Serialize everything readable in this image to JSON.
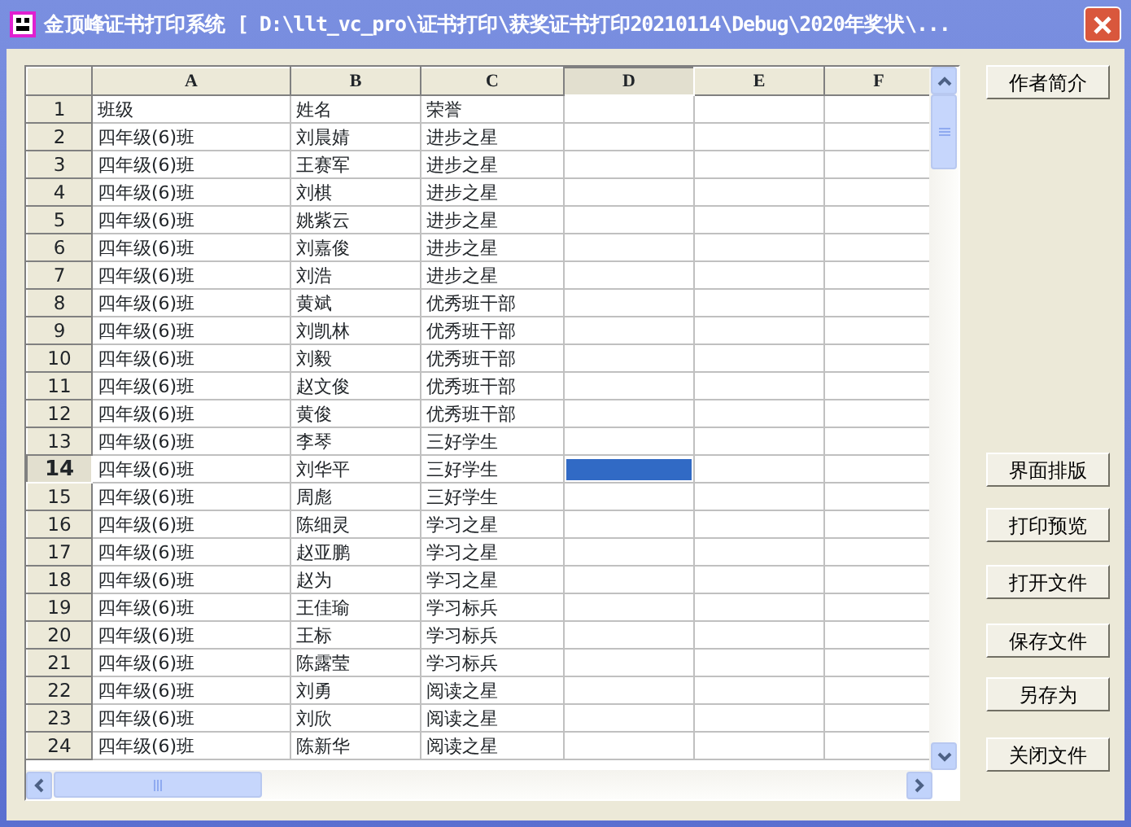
{
  "window": {
    "title": "金顶峰证书打印系统 [ D:\\llt_vc_pro\\证书打印\\获奖证书打印20210114\\Debug\\2020年奖状\\..."
  },
  "columns": [
    {
      "label": "A",
      "selected": false
    },
    {
      "label": "B",
      "selected": false
    },
    {
      "label": "C",
      "selected": false
    },
    {
      "label": "D",
      "selected": true
    },
    {
      "label": "E",
      "selected": false
    },
    {
      "label": "F",
      "selected": false
    }
  ],
  "rows": [
    {
      "label": "1",
      "selected": false,
      "cells": [
        "班级",
        "姓名",
        "荣誉"
      ]
    },
    {
      "label": "2",
      "selected": false,
      "cells": [
        "四年级(6)班",
        "刘晨婧",
        "进步之星"
      ]
    },
    {
      "label": "3",
      "selected": false,
      "cells": [
        "四年级(6)班",
        "王赛军",
        "进步之星"
      ]
    },
    {
      "label": "4",
      "selected": false,
      "cells": [
        "四年级(6)班",
        "刘棋",
        "进步之星"
      ]
    },
    {
      "label": "5",
      "selected": false,
      "cells": [
        "四年级(6)班",
        "姚紫云",
        "进步之星"
      ]
    },
    {
      "label": "6",
      "selected": false,
      "cells": [
        "四年级(6)班",
        "刘嘉俊",
        "进步之星"
      ]
    },
    {
      "label": "7",
      "selected": false,
      "cells": [
        "四年级(6)班",
        "刘浩",
        "进步之星"
      ]
    },
    {
      "label": "8",
      "selected": false,
      "cells": [
        "四年级(6)班",
        "黄斌",
        "优秀班干部"
      ]
    },
    {
      "label": "9",
      "selected": false,
      "cells": [
        "四年级(6)班",
        "刘凯林",
        "优秀班干部"
      ]
    },
    {
      "label": "10",
      "selected": false,
      "cells": [
        "四年级(6)班",
        "刘毅",
        "优秀班干部"
      ]
    },
    {
      "label": "11",
      "selected": false,
      "cells": [
        "四年级(6)班",
        "赵文俊",
        "优秀班干部"
      ]
    },
    {
      "label": "12",
      "selected": false,
      "cells": [
        "四年级(6)班",
        "黄俊",
        "优秀班干部"
      ]
    },
    {
      "label": "13",
      "selected": false,
      "cells": [
        "四年级(6)班",
        "李琴",
        "三好学生"
      ]
    },
    {
      "label": "14",
      "selected": true,
      "cells": [
        "四年级(6)班",
        "刘华平",
        "三好学生"
      ]
    },
    {
      "label": "15",
      "selected": false,
      "cells": [
        "四年级(6)班",
        "周彪",
        "三好学生"
      ]
    },
    {
      "label": "16",
      "selected": false,
      "cells": [
        "四年级(6)班",
        "陈细灵",
        "学习之星"
      ]
    },
    {
      "label": "17",
      "selected": false,
      "cells": [
        "四年级(6)班",
        "赵亚鹏",
        "学习之星"
      ]
    },
    {
      "label": "18",
      "selected": false,
      "cells": [
        "四年级(6)班",
        "赵为",
        "学习之星"
      ]
    },
    {
      "label": "19",
      "selected": false,
      "cells": [
        "四年级(6)班",
        "王佳瑜",
        "学习标兵"
      ]
    },
    {
      "label": "20",
      "selected": false,
      "cells": [
        "四年级(6)班",
        "王标",
        "学习标兵"
      ]
    },
    {
      "label": "21",
      "selected": false,
      "cells": [
        "四年级(6)班",
        "陈露莹",
        "学习标兵"
      ]
    },
    {
      "label": "22",
      "selected": false,
      "cells": [
        "四年级(6)班",
        "刘勇",
        "阅读之星"
      ]
    },
    {
      "label": "23",
      "selected": false,
      "cells": [
        "四年级(6)班",
        "刘欣",
        "阅读之星"
      ]
    },
    {
      "label": "24",
      "selected": false,
      "cells": [
        "四年级(6)班",
        "陈新华",
        "阅读之星"
      ]
    }
  ],
  "buttons": [
    {
      "label": "作者简介"
    },
    {
      "label": "界面排版"
    },
    {
      "label": "打印预览"
    },
    {
      "label": "打开文件"
    },
    {
      "label": "保存文件"
    },
    {
      "label": "另存为"
    },
    {
      "label": "关闭文件"
    }
  ]
}
